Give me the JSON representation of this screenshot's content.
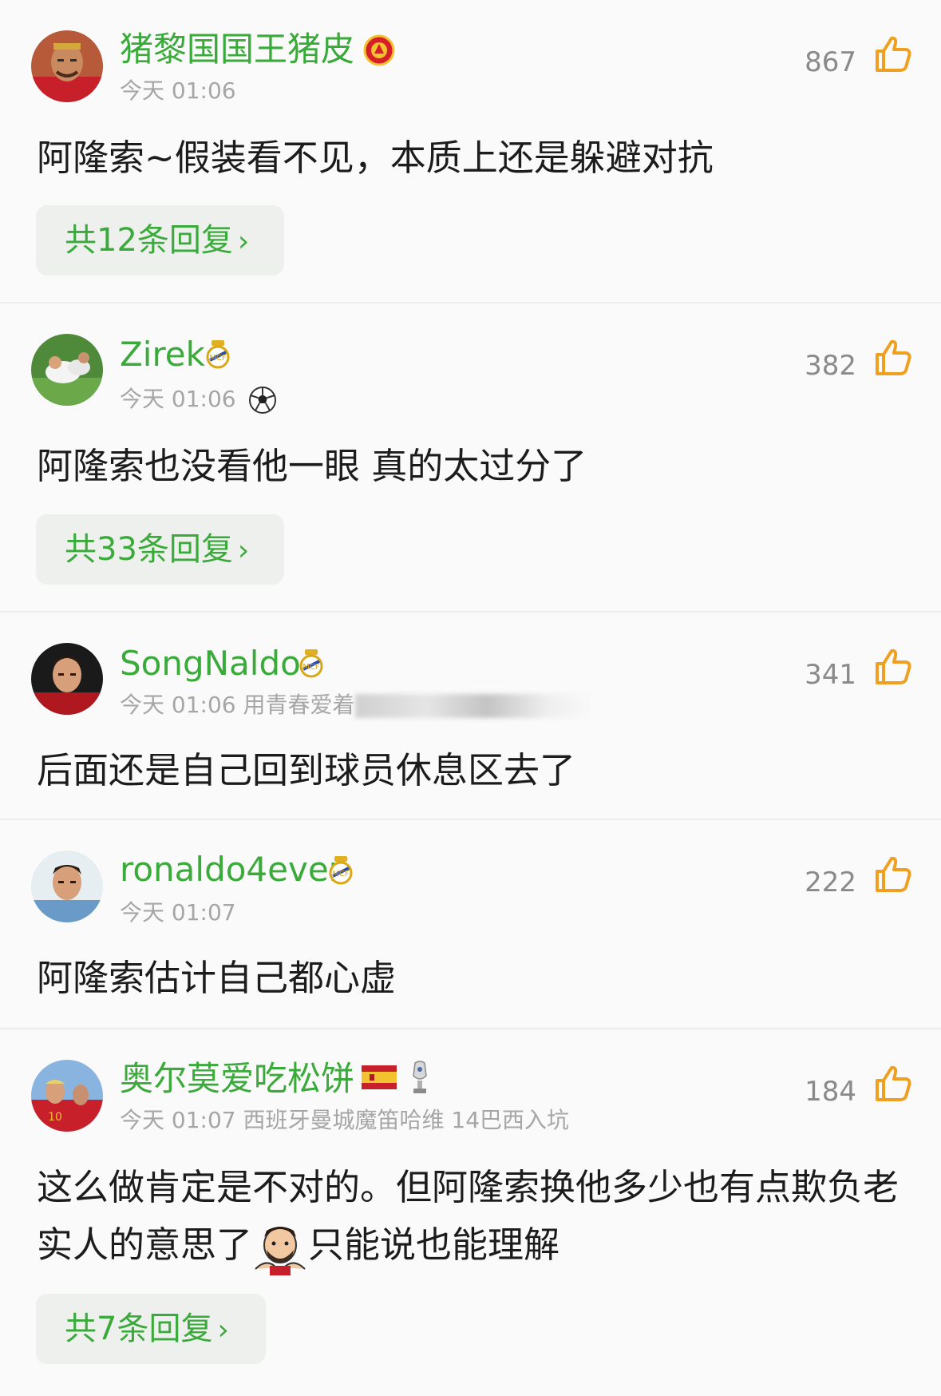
{
  "comments": [
    {
      "username": "猪黎国国王猪皮",
      "badges": [
        "manutd-crest-icon"
      ],
      "meta": "今天 01:06",
      "likes": "867",
      "text": "阿隆索~假装看不见，本质上还是躲避对抗",
      "replies": "共12条回复"
    },
    {
      "username": "Zirek",
      "badges": [
        "realmadrid-crest-icon"
      ],
      "meta": "今天 01:06",
      "meta_icon": "soccer-ball-icon",
      "likes": "382",
      "text": "阿隆索也没看他一眼 真的太过分了",
      "replies": "共33条回复"
    },
    {
      "username": "SongNaldo",
      "badges": [
        "realmadrid-crest-icon"
      ],
      "meta": "今天 01:06 用青春爱着",
      "likes": "341",
      "text": "后面还是自己回到球员休息区去了"
    },
    {
      "username": "ronaldo4ever",
      "badges": [
        "realmadrid-crest-icon"
      ],
      "meta": "今天 01:07",
      "likes": "222",
      "text": "阿隆索估计自己都心虚"
    },
    {
      "username": "奥尔莫爱吃松饼",
      "badges": [
        "spain-flag-icon",
        "euro-trophy-icon"
      ],
      "meta": "今天 01:07 西班牙曼城魔笛哈维 14巴西入坑",
      "likes": "184",
      "text_part1": "这么做肯定是不对的。但阿隆索换他多少也有点欺负老实人的意思了",
      "text_part2": "只能说也能理解",
      "replies": "共7条回复"
    }
  ],
  "colors": {
    "username": "#3aaa3a",
    "like_icon": "#f0a020",
    "reply_bg": "#eef0ee"
  }
}
